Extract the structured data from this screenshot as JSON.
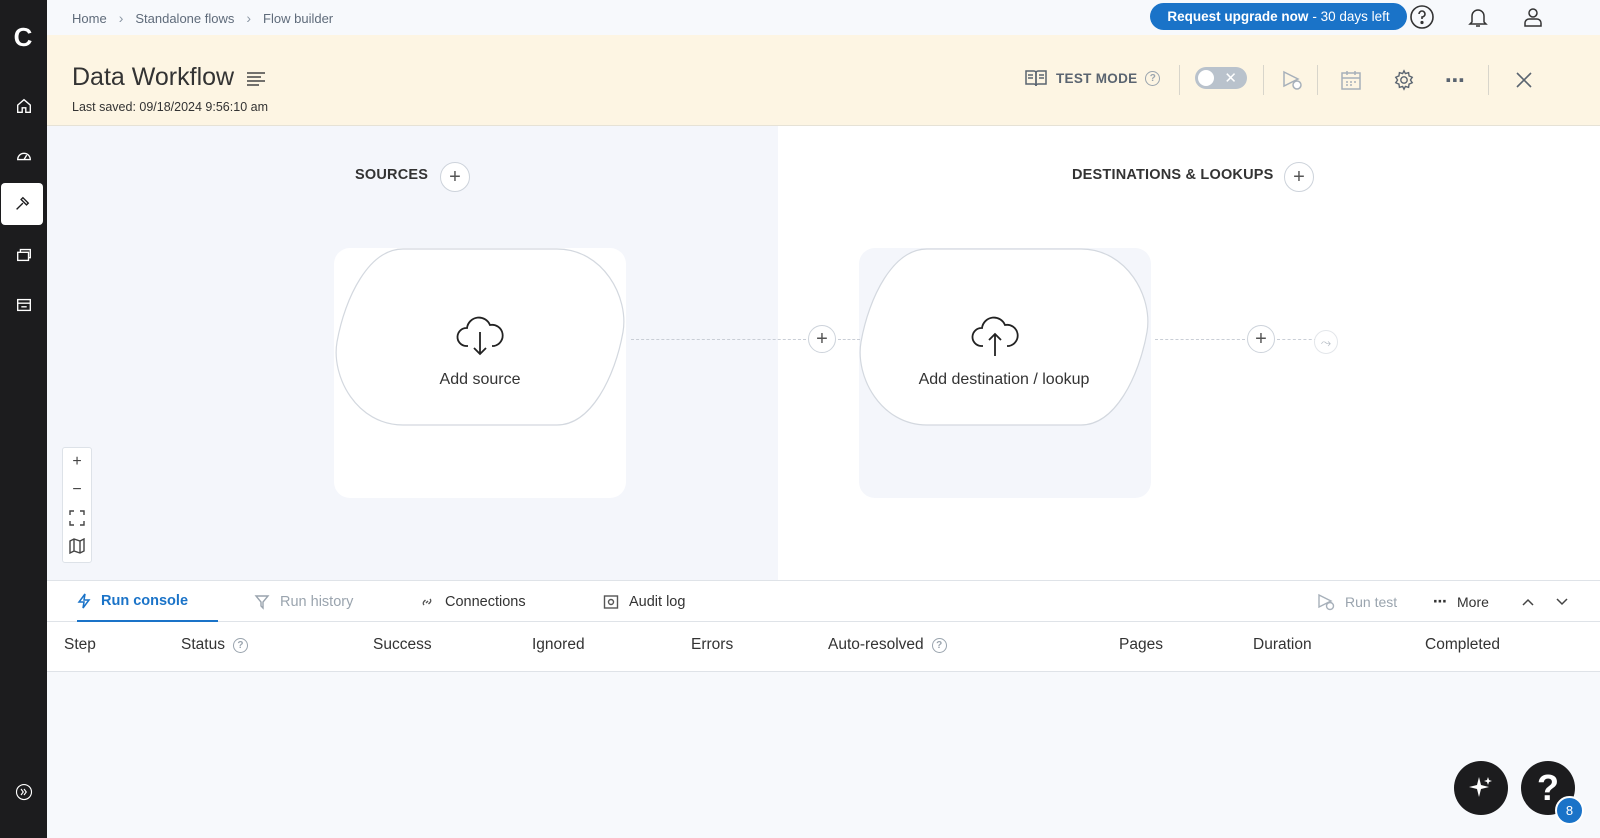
{
  "nav": {
    "logo": "C",
    "items": [
      "home-icon",
      "dashboard-icon",
      "builder-icon",
      "resources-icon",
      "marketplace-icon"
    ],
    "expand": "expand-icon"
  },
  "topbar": {
    "breadcrumb": [
      "Home",
      "Standalone flows",
      "Flow builder"
    ],
    "upgrade_label": "Request upgrade now",
    "upgrade_days": "- 30 days left"
  },
  "header": {
    "title": "Data Workflow",
    "last_saved": "Last saved: 09/18/2024 9:56:10 am",
    "test_mode_label": "TEST MODE",
    "test_mode_enabled": false
  },
  "canvas": {
    "sources_label": "SOURCES",
    "destinations_label": "DESTINATIONS & LOOKUPS",
    "add_source_label": "Add source",
    "add_destination_label": "Add destination / lookup",
    "zoom_controls": [
      "zoom-in-icon",
      "zoom-out-icon",
      "fit-view-icon",
      "map-icon"
    ]
  },
  "console": {
    "tabs": [
      {
        "label": "Run console",
        "active": true
      },
      {
        "label": "Run history",
        "active": false
      },
      {
        "label": "Connections",
        "active": false
      },
      {
        "label": "Audit log",
        "active": false
      }
    ],
    "run_test_label": "Run test",
    "more_label": "More",
    "columns": [
      "Step",
      "Status",
      "Success",
      "Ignored",
      "Errors",
      "Auto-resolved",
      "Pages",
      "Duration",
      "Completed"
    ]
  },
  "help": {
    "badge_count": "8"
  },
  "colors": {
    "accent": "#1a73c8",
    "header_bg": "#fdf5e3",
    "nav_bg": "#1c1c1e"
  }
}
